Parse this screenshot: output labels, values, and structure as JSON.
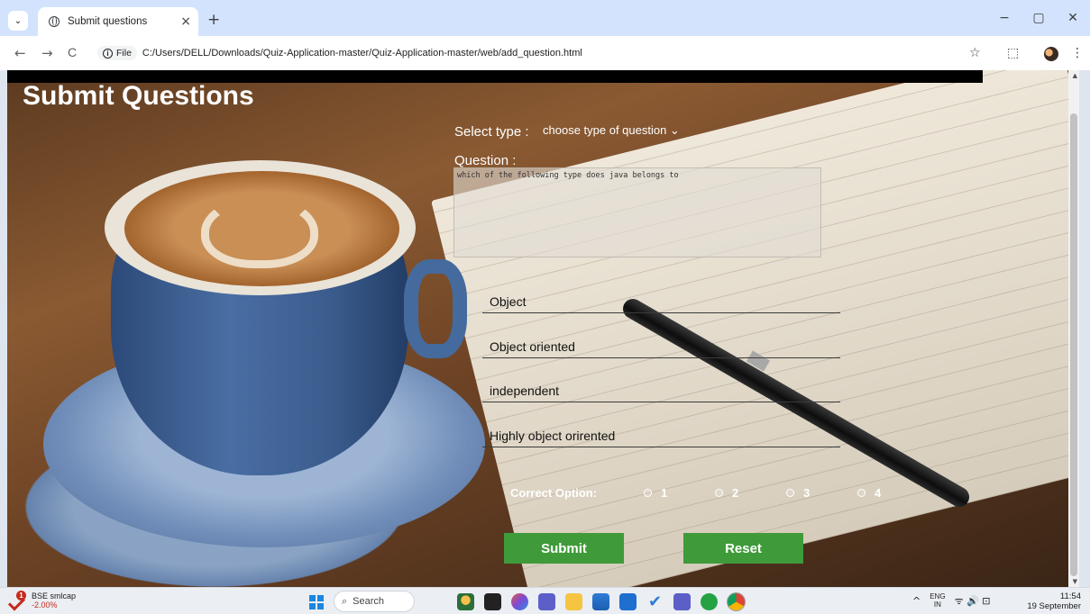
{
  "browser": {
    "tab_title": "Submit questions",
    "close_tab": "×",
    "new_tab": "+",
    "tab_list": "⌄",
    "back": "←",
    "forward": "→",
    "reload": "C",
    "site_info_label": "File",
    "url": "C:/Users/DELL/Downloads/Quiz-Application-master/Quiz-Application-master/web/add_question.html",
    "bookmark": "☆",
    "extensions": "⬚",
    "menu": "⋮",
    "minimize": "−",
    "restore": "▢",
    "close_window": "✕"
  },
  "page": {
    "title": "Submit Questions",
    "select_type_label": "Select type :",
    "select_type_value": "choose type of question ⌄",
    "question_label": "Question :",
    "question_value": "which of the following type does java belongs to",
    "options": [
      {
        "value": "Object"
      },
      {
        "value": "Object oriented"
      },
      {
        "value": "independent"
      },
      {
        "value": "Highly object orirented"
      }
    ],
    "correct_option_label": "Correct Option:",
    "correct_choices": [
      "1",
      "2",
      "3",
      "4"
    ],
    "submit_label": "Submit",
    "reset_label": "Reset"
  },
  "taskbar": {
    "stock_name": "BSE smlcap",
    "stock_change": "-2.00%",
    "stock_badge": "1",
    "search_label": "Search",
    "tray_chevron": "^",
    "lang_top": "ENG",
    "lang_bottom": "IN",
    "tray_icons": "ᯤ 🔊 ⊡",
    "time": "11:54",
    "date": "19 September"
  },
  "colors": {
    "accent_button": "#3f9b3a",
    "tabstrip": "#d3e3fd",
    "stock_negative": "#c42b1c"
  }
}
